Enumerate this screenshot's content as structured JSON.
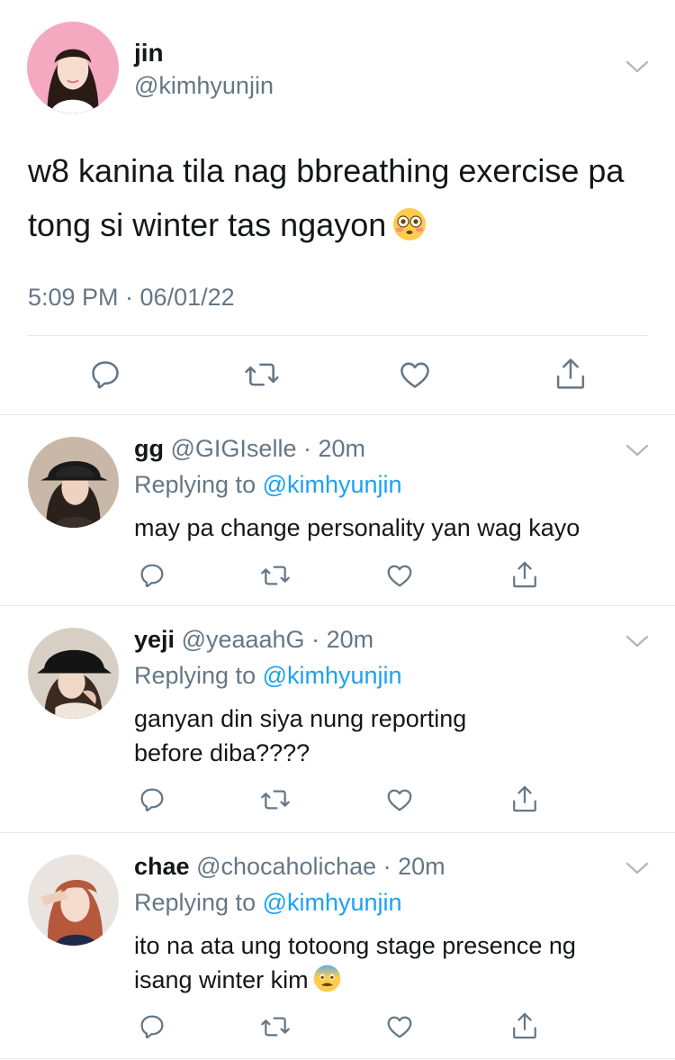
{
  "main_tweet": {
    "name": "jin",
    "handle": "@kimhyunjin",
    "text": "w8 kanina tila nag bbreathing exercise pa tong si winter tas ngayon",
    "emoji": "flushed-face",
    "timestamp": "5:09 PM · 06/01/22"
  },
  "replies": [
    {
      "name": "gg",
      "handle": "@GIGIselle",
      "dot": " · ",
      "time": "20m",
      "replying_prefix": "Replying to ",
      "replying_to": "@kimhyunjin",
      "text": "may pa change personality yan wag kayo"
    },
    {
      "name": "yeji",
      "handle": "@yeaaahG",
      "dot": " · ",
      "time": "20m",
      "replying_prefix": "Replying to ",
      "replying_to": "@kimhyunjin",
      "text_line1": "ganyan din siya nung reporting",
      "text_line2": "before diba????"
    },
    {
      "name": "chae",
      "handle": "@chocaholichae",
      "dot": " · ",
      "time": "20m",
      "replying_prefix": "Replying to ",
      "replying_to": "@kimhyunjin",
      "text_line1": "ito na ata ung totoong stage presence ng",
      "text_line2": "isang winter kim",
      "emoji": "fearful-face"
    }
  ],
  "icons": {
    "reply": "reply-icon",
    "retweet": "retweet-icon",
    "like": "heart-icon",
    "share": "share-icon",
    "more": "chevron-down-icon"
  },
  "colors": {
    "text": "#14171a",
    "secondary": "#657786",
    "link": "#1da1f2",
    "divider": "#e1e8ed"
  }
}
